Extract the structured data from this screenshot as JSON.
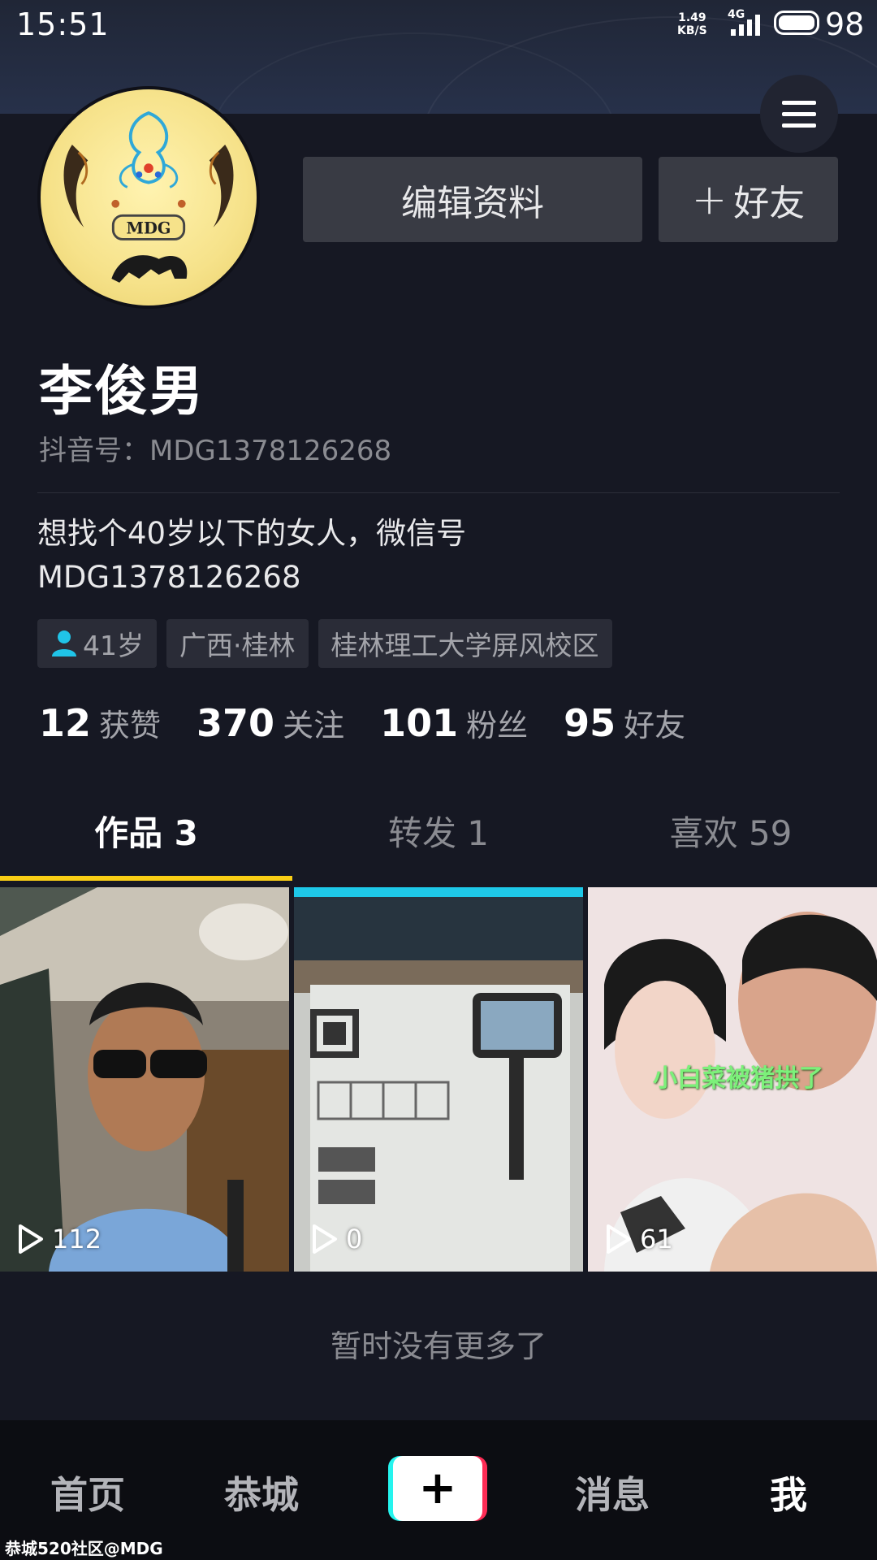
{
  "status_bar": {
    "time": "15:51",
    "net_speed_value": "1.49",
    "net_speed_unit": "KB/S",
    "network": "4G",
    "battery": "98"
  },
  "profile": {
    "name": "李俊男",
    "douyin_id": "抖音号：MDG1378126268",
    "bio_line1": "想找个40岁以下的女人，微信号",
    "bio_line2": "MDG1378126268",
    "avatar_logo_text": "MDG"
  },
  "actions": {
    "edit_profile": "编辑资料",
    "add_friend_plus": "+",
    "add_friend": "好友"
  },
  "tags": {
    "age": "41岁",
    "location": "广西·桂林",
    "school": "桂林理工大学屏风校区"
  },
  "stats": [
    {
      "num": "12",
      "label": "获赞"
    },
    {
      "num": "370",
      "label": "关注"
    },
    {
      "num": "101",
      "label": "粉丝"
    },
    {
      "num": "95",
      "label": "好友"
    }
  ],
  "tabs": [
    {
      "label": "作品 3",
      "active": true
    },
    {
      "label": "转发 1",
      "active": false
    },
    {
      "label": "喜欢 59",
      "active": false
    }
  ],
  "videos": [
    {
      "plays": "112"
    },
    {
      "plays": "0"
    },
    {
      "plays": "61",
      "caption": "小白菜被猪拱了"
    }
  ],
  "no_more_text": "暂时没有更多了",
  "bottom_nav": {
    "home": "首页",
    "city": "恭城",
    "create": "+",
    "messages": "消息",
    "me": "我"
  },
  "watermark": "恭城520社区@MDG",
  "colors": {
    "background": "#161823",
    "tab_indicator": "#face15",
    "accent_cyan": "#25f4ee",
    "accent_red": "#fe2c55"
  }
}
